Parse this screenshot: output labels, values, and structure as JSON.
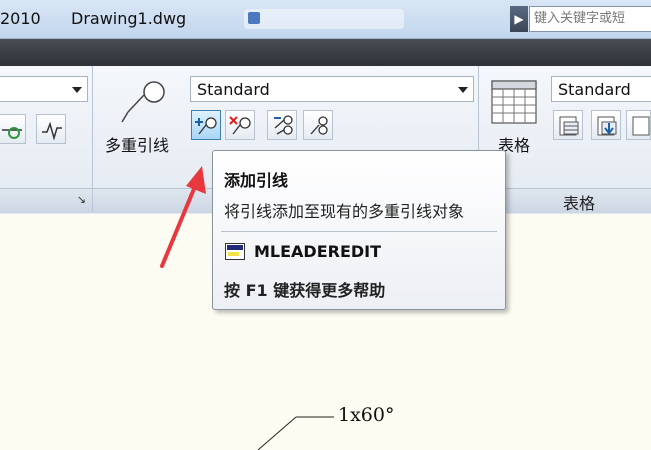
{
  "titlebar": {
    "year": "2010",
    "document": "Drawing1.dwg",
    "search_placeholder": "键入关键字或短"
  },
  "ribbon": {
    "left_panel": {
      "dropdown_arrow": "chevron-down-icon"
    },
    "mleader_panel": {
      "big_button_label": "多重引线",
      "style_dropdown": "Standard",
      "tools": [
        "add-leader",
        "remove-leader",
        "align-leaders",
        "collect-leaders"
      ]
    },
    "table_panel": {
      "big_button_label": "表格",
      "style_dropdown": "Standard",
      "title": "表格"
    }
  },
  "tooltip": {
    "title": "添加引线",
    "description": "将引线添加至现有的多重引线对象",
    "command": "MLEADEREDIT",
    "help": "按 F1 键获得更多帮助"
  },
  "canvas": {
    "dimension_text": "1x60°"
  },
  "colors": {
    "annotation_arrow": "#e8383d",
    "active_button": "#a9d6f7",
    "canvas_bg": "#fdfcf3"
  }
}
